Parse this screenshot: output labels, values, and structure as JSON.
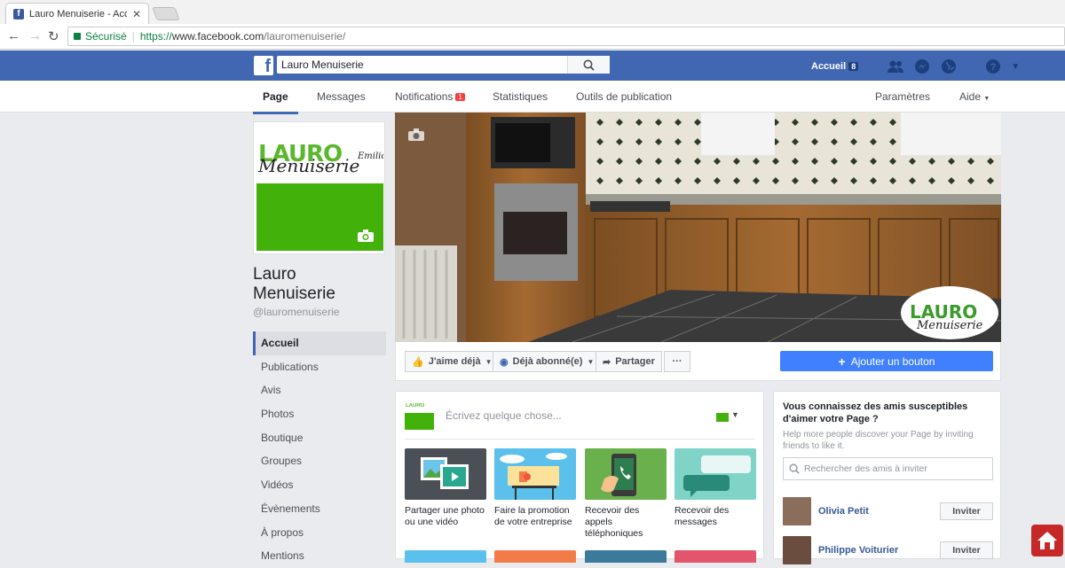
{
  "browser": {
    "tab_title": "Lauro Menuiserie - Accue",
    "tab_close": "✕",
    "secure_label": "Sécurisé",
    "url_scheme": "https://",
    "url_host": "www.facebook.com",
    "url_path": "/lauromenuiserie/"
  },
  "topbar": {
    "logo": "f",
    "search_value": "Lauro Menuiserie",
    "home_label": "Accueil",
    "home_badge": "8",
    "brand_color": "#4267b2"
  },
  "page_nav": {
    "tabs": [
      {
        "label": "Page"
      },
      {
        "label": "Messages"
      },
      {
        "label": "Notifications",
        "badge": "1"
      },
      {
        "label": "Statistiques"
      },
      {
        "label": "Outils de publication"
      }
    ],
    "settings_label": "Paramètres",
    "help_label": "Aide"
  },
  "page": {
    "logo_text": "LAURO",
    "logo_script": "Menuiserie",
    "logo_emilio": "Emilio",
    "name": "Lauro Menuiserie",
    "handle": "@lauromenuiserie"
  },
  "left_nav": [
    "Accueil",
    "Publications",
    "Avis",
    "Photos",
    "Boutique",
    "Groupes",
    "Vidéos",
    "Évènements",
    "À propos",
    "Mentions"
  ],
  "actions": {
    "like_label": "J'aime déjà",
    "follow_label": "Déjà abonné(e)",
    "share_label": "Partager",
    "more_label": "···",
    "add_button_label": "Ajouter un bouton"
  },
  "composer": {
    "avatar_text": "LAURO",
    "placeholder": "Écrivez quelque chose...",
    "cards": [
      {
        "label": "Partager une photo ou une vidéo",
        "color": "#4b4f56"
      },
      {
        "label": "Faire la promotion de votre entreprise",
        "color": "#5bc0eb"
      },
      {
        "label": "Recevoir des appels téléphoniques",
        "color": "#6ab04c"
      },
      {
        "label": "Recevoir des messages",
        "color": "#7fd3c7"
      }
    ]
  },
  "invite": {
    "title": "Vous connaissez des amis susceptibles d'aimer votre Page ?",
    "subtitle": "Help more people discover your Page by inviting friends to like it.",
    "search_placeholder": "Rechercher des amis à inviter",
    "friends": [
      {
        "name": "Olivia Petit",
        "button": "Inviter"
      },
      {
        "name": "Philippe Voiturier",
        "button": "Inviter"
      }
    ]
  }
}
